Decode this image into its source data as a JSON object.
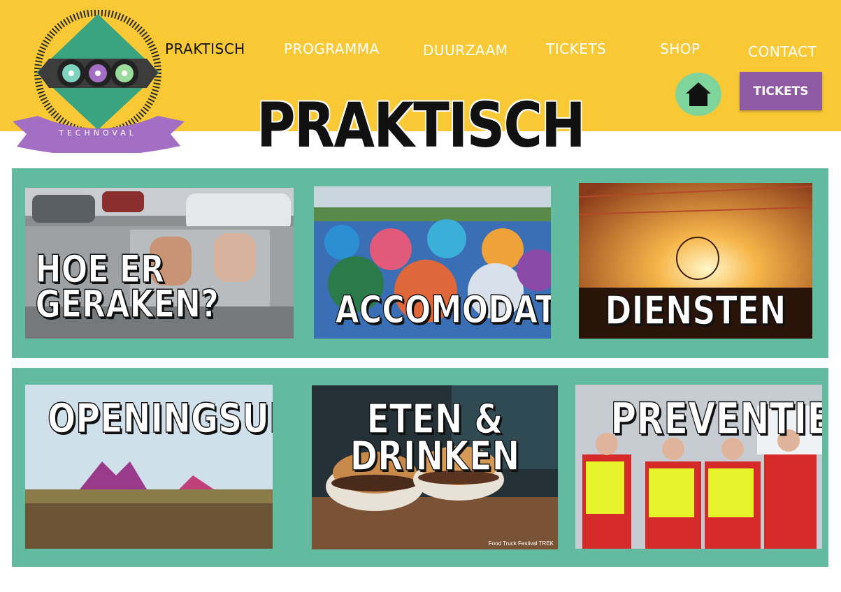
{
  "logo": {
    "text": "TECHNOVAL",
    "icon": "technoval-logo"
  },
  "nav": [
    {
      "label": "PRAKTISCH",
      "active": true
    },
    {
      "label": "PROGRAMMA",
      "active": false
    },
    {
      "label": "DUURZAAM",
      "active": false
    },
    {
      "label": "TICKETS",
      "active": false
    },
    {
      "label": "SHOP",
      "active": false
    },
    {
      "label": "CONTACT",
      "active": false
    }
  ],
  "home_icon": "home-icon",
  "tickets_button": "TICKETS",
  "page_title": "PRAKTISCH",
  "cards": [
    {
      "label": "HOE ER GERAKEN?"
    },
    {
      "label": "ACCOMODATIES"
    },
    {
      "label": "DIENSTEN"
    },
    {
      "label": "OPENINGSUREN"
    },
    {
      "label": "ETEN & DRINKEN",
      "credit": "Food Truck Festival TREK"
    },
    {
      "label": "PREVENTIE"
    }
  ],
  "colors": {
    "header": "#f8c935",
    "band": "#63bb9f",
    "tickets_button": "#8e5aa3",
    "home_button": "#7fd49c",
    "ribbon": "#a36fc4"
  }
}
